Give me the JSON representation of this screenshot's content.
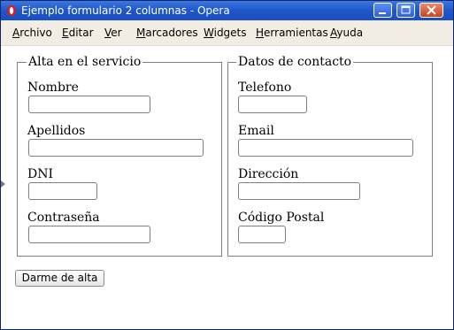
{
  "window": {
    "title": "Ejemplo formulario 2 columnas - Opera",
    "icons": {
      "app": "opera-icon",
      "minimize": "minimize-icon",
      "maximize": "maximize-icon",
      "close": "close-icon"
    }
  },
  "menu": {
    "items": [
      {
        "accel": "A",
        "rest": "rchivo"
      },
      {
        "accel": "E",
        "rest": "ditar"
      },
      {
        "accel": "V",
        "rest": "er"
      },
      {
        "accel": "M",
        "rest": "arcadores"
      },
      {
        "accel": "W",
        "rest": "idgets"
      },
      {
        "accel": "H",
        "rest": "erramientas"
      },
      {
        "accel": "A",
        "rest": "yuda"
      }
    ]
  },
  "form": {
    "service": {
      "legend": "Alta en el servicio",
      "nombre": {
        "label": "Nombre",
        "value": ""
      },
      "apellidos": {
        "label": "Apellidos",
        "value": ""
      },
      "dni": {
        "label": "DNI",
        "value": ""
      },
      "contrasena": {
        "label": "Contraseña",
        "value": ""
      }
    },
    "contact": {
      "legend": "Datos de contacto",
      "telefono": {
        "label": "Telefono",
        "value": ""
      },
      "email": {
        "label": "Email",
        "value": ""
      },
      "direccion": {
        "label": "Dirección",
        "value": ""
      },
      "codigo_postal": {
        "label": "Código Postal",
        "value": ""
      }
    },
    "submit_label": "Darme de alta"
  },
  "colors": {
    "titlebar": "#2a63d4",
    "menubar": "#f1ede3",
    "fieldset_border": "#7f7f7f",
    "close_button": "#d25a35"
  }
}
